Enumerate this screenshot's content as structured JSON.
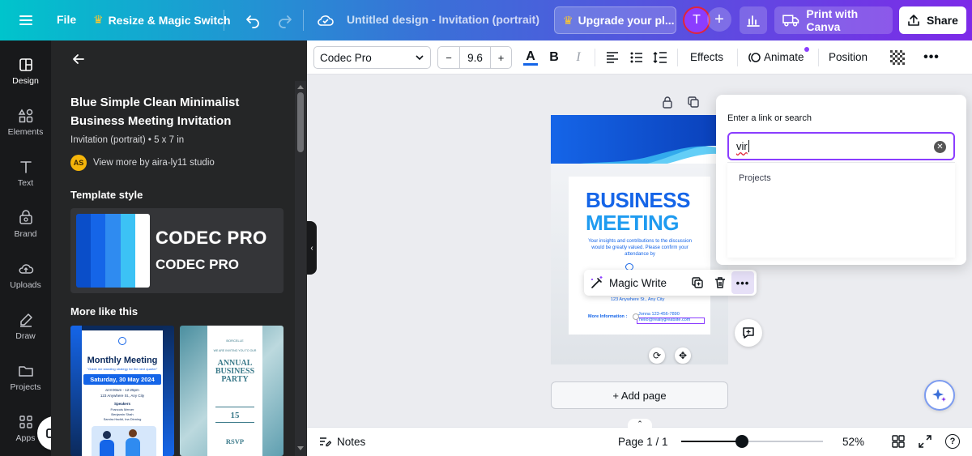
{
  "topbar": {
    "file_label": "File",
    "resize_label": "Resize & Magic Switch",
    "doc_title": "Untitled design - Invitation (portrait)",
    "upgrade_label": "Upgrade your pl...",
    "avatar_letter": "T",
    "print_label": "Print with Canva",
    "share_label": "Share"
  },
  "rail": {
    "items": [
      "Design",
      "Elements",
      "Text",
      "Brand",
      "Uploads",
      "Draw",
      "Projects",
      "Apps"
    ]
  },
  "panel": {
    "template_title": "Blue Simple Clean Minimalist Business Meeting Invitation",
    "template_sub": "Invitation (portrait) • 5 x 7 in",
    "author_initials": "AS",
    "author_link": "View more by aira-ly11 studio",
    "template_style_heading": "Template style",
    "font_sample_1": "CODEC PRO",
    "font_sample_2": "CODEC PRO",
    "swatches": [
      "#0a4ec9",
      "#1565e8",
      "#2f8bf0",
      "#3cc2f5",
      "#ffffff"
    ],
    "more_heading": "More like this",
    "thumb1": {
      "title": "Monthly Meeting",
      "quote": "\"Guide me standing strategy for the next quarter\"",
      "date": "Saturday, 30 May 2024",
      "time": "at 8:00am - 12:25pm",
      "city": "123 Anywhere St., Any City",
      "speakers": "Speakers",
      "s1": "Francois Mercer",
      "s2": "Benjamin Shah",
      "s3": "Samira Hadid, Ina Dinning"
    },
    "thumb2": {
      "org": "BORCELLE",
      "header": "WE ARE INVITING YOU TO OUR",
      "title_line1": "ANNUAL",
      "title_line2": "BUSINESS",
      "title_line3": "PARTY",
      "date": "15",
      "rsvp": "RSVP"
    }
  },
  "editor": {
    "font_name": "Codec Pro",
    "font_size": "9.6",
    "effects_label": "Effects",
    "animate_label": "Animate",
    "position_label": "Position"
  },
  "design": {
    "heading1": "BUSINESS",
    "heading2": "MEETING",
    "body": "Your insights and contributions to the discussion would be greatly valued. Please confirm your attendance by",
    "address": "123 Anywhere St., Any City",
    "more_info": "More Information :",
    "phone": "Jonna 123-456-7890",
    "email": "hello@reallygreatsite.com"
  },
  "context_menu": {
    "magic_write_label": "Magic Write"
  },
  "link_popup": {
    "label": "Enter a link or search",
    "input_value": "vir",
    "projects_label": "Projects"
  },
  "canvas": {
    "add_page_label": "+ Add page"
  },
  "bottombar": {
    "notes_label": "Notes",
    "page_label": "Page 1 / 1",
    "zoom_label": "52%",
    "zoom_fraction": 0.43
  },
  "colors": {
    "accent": "#8b3dff",
    "brand_blue": "#1565e8"
  }
}
